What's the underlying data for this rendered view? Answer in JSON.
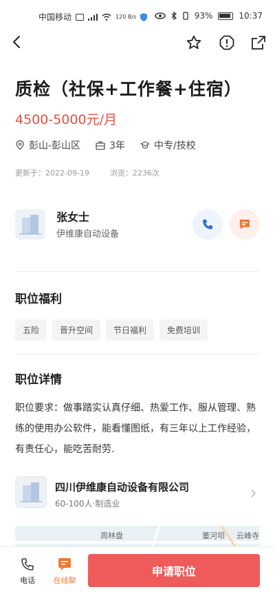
{
  "status_bar": {
    "carrier": "中国移动",
    "network_speed": "120 B/s",
    "battery": "93%",
    "time": "10:37"
  },
  "job": {
    "title": "质检（社保+工作餐+住宿）",
    "salary": "4500-5000元/月",
    "location": "彭山-彭山区",
    "experience": "3年",
    "education": "中专/技校",
    "updated": "更新于：2022-09-19",
    "views": "浏览：2236次"
  },
  "recruiter": {
    "name": "张女士",
    "company": "伊维康自动设备"
  },
  "benefits": {
    "title": "职位福利",
    "tags": [
      "五险",
      "晋升空间",
      "节日福利",
      "免费培训"
    ]
  },
  "details": {
    "title": "职位详情",
    "text": "职位要求：做事踏实认真仔细、热爱工作、服从管理、熟练的使用办公软件，能看懂图纸，有三年以上工作经验，有责任心，能吃苦耐劳."
  },
  "company_card": {
    "name": "四川伊维康自动设备有限公司",
    "info": "60-100人·制造业"
  },
  "map": {
    "places": [
      "周林盘",
      "董河坝",
      "云峰寺"
    ]
  },
  "bottom_bar": {
    "call_label": "电话",
    "chat_label": "在线聊",
    "apply_label": "申请职位"
  },
  "colors": {
    "salary": "#e5513f",
    "apply": "#ef5a5a",
    "chat_accent": "#f07a35",
    "call_accent": "#2f6fd6"
  }
}
